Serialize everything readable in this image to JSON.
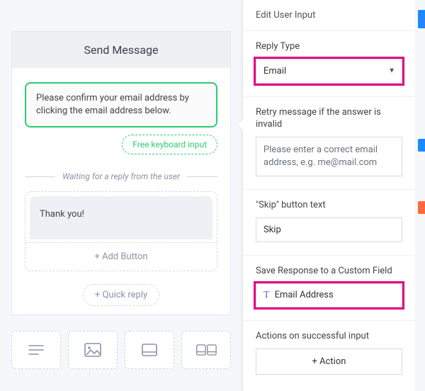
{
  "header": {
    "title": "Send Message"
  },
  "bot_message": "Please confirm your email address by clicking the email address below.",
  "free_input_chip": "Free keyboard input",
  "waiting_text": "Waiting for a reply from the user",
  "thanks_text": "Thank you!",
  "add_button": "+ Add Button",
  "quick_reply": "+ Quick reply",
  "panel": {
    "title": "Edit User Input",
    "reply_type": {
      "label": "Reply Type",
      "value": "Email"
    },
    "retry": {
      "label": "Retry message if the answer is invalid",
      "value": "Please enter a correct email address, e.g. me@mail.com"
    },
    "skip": {
      "label": "\"Skip\" button text",
      "value": "Skip"
    },
    "custom_field": {
      "label": "Save Response to a Custom Field",
      "value": "Email Address"
    },
    "actions": {
      "label": "Actions on successful input",
      "button": "+ Action"
    }
  }
}
